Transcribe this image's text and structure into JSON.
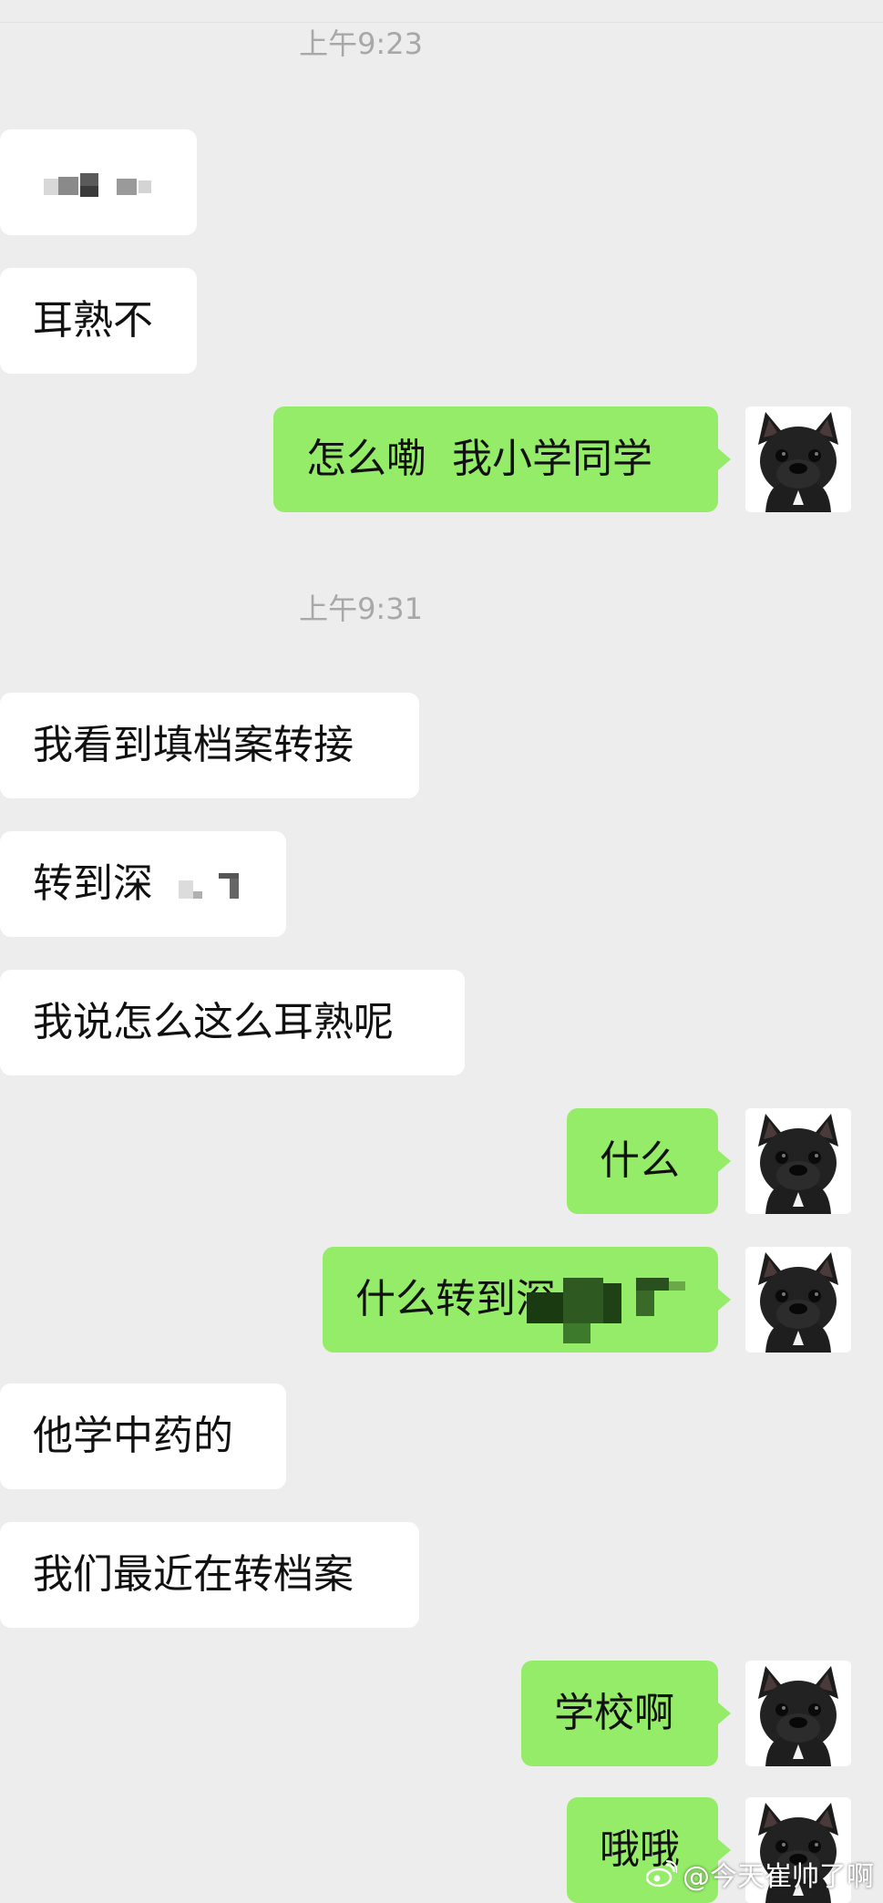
{
  "timestamps": [
    "上午9:23",
    "上午9:31"
  ],
  "messages": [
    {
      "side": "in",
      "text": ""
    },
    {
      "side": "in",
      "text": "耳熟不"
    },
    {
      "side": "out",
      "text": "怎么嘞  我小学同学"
    },
    {
      "side": "in",
      "text": "我看到填档案转接"
    },
    {
      "side": "in",
      "text": "转到深"
    },
    {
      "side": "in",
      "text": "我说怎么这么耳熟呢"
    },
    {
      "side": "out",
      "text": "什么"
    },
    {
      "side": "out",
      "text": "什么转到深"
    },
    {
      "side": "in",
      "text": "他学中药的"
    },
    {
      "side": "in",
      "text": "我们最近在转档案"
    },
    {
      "side": "out",
      "text": "学校啊"
    },
    {
      "side": "out",
      "text": "哦哦"
    }
  ],
  "watermark": {
    "text": "@今天崔帅了啊",
    "icon": "weibo-icon"
  },
  "avatar": {
    "icon": "french-bulldog-avatar-icon"
  },
  "colors": {
    "background": "#ededed",
    "incoming_bubble": "#ffffff",
    "outgoing_bubble": "#95ec69",
    "timestamp_text": "#a8a8a8"
  }
}
